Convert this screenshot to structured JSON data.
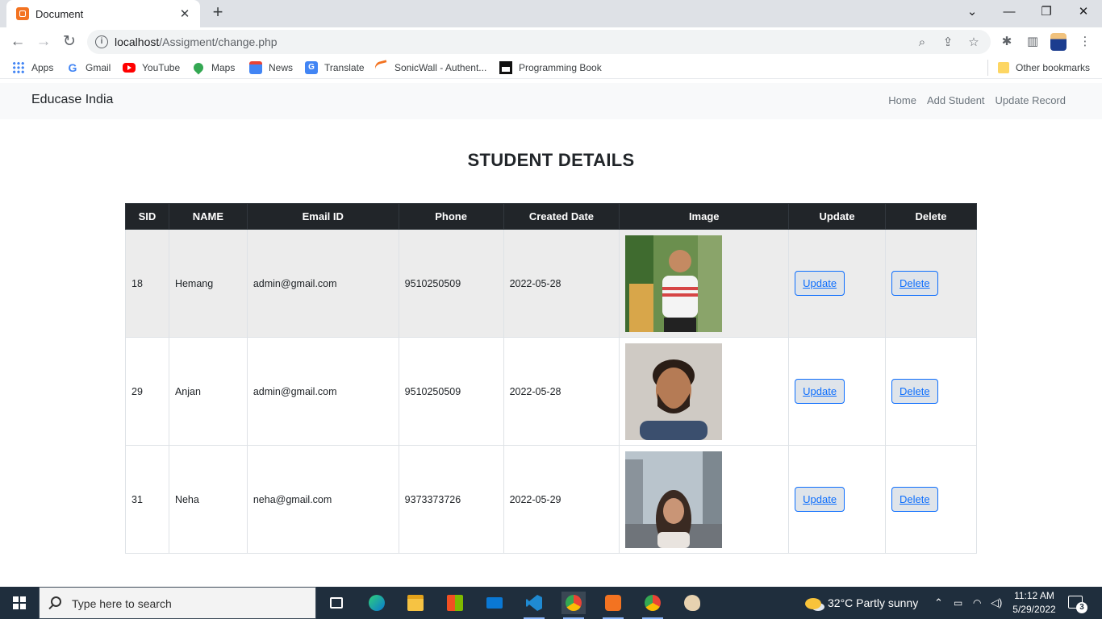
{
  "browser": {
    "tab_title": "Document",
    "url_host": "localhost",
    "url_path": "/Assigment/change.php",
    "bookmarks": [
      {
        "label": "Apps",
        "icon": "apps-grid-icon"
      },
      {
        "label": "Gmail",
        "icon": "google-icon"
      },
      {
        "label": "YouTube",
        "icon": "youtube-icon"
      },
      {
        "label": "Maps",
        "icon": "maps-pin-icon"
      },
      {
        "label": "News",
        "icon": "news-icon"
      },
      {
        "label": "Translate",
        "icon": "translate-icon"
      },
      {
        "label": "SonicWall - Authent...",
        "icon": "sonicwall-icon"
      },
      {
        "label": "Programming Book",
        "icon": "book-icon"
      }
    ],
    "other_bookmarks": "Other bookmarks"
  },
  "navbar": {
    "brand": "Educase India",
    "links": [
      "Home",
      "Add Student",
      "Update Record"
    ]
  },
  "page": {
    "heading": "STUDENT DETAILS"
  },
  "table": {
    "headers": [
      "SID",
      "NAME",
      "Email ID",
      "Phone",
      "Created Date",
      "Image",
      "Update",
      "Delete"
    ],
    "rows": [
      {
        "sid": "18",
        "name": "Hemang",
        "email": "admin@gmail.com",
        "phone": "9510250509",
        "created": "2022-05-28",
        "update_label": "Update",
        "delete_label": "Delete"
      },
      {
        "sid": "29",
        "name": "Anjan",
        "email": "admin@gmail.com",
        "phone": "9510250509",
        "created": "2022-05-28",
        "update_label": "Update",
        "delete_label": "Delete"
      },
      {
        "sid": "31",
        "name": "Neha",
        "email": "neha@gmail.com",
        "phone": "9373373726",
        "created": "2022-05-29",
        "update_label": "Update",
        "delete_label": "Delete"
      }
    ]
  },
  "taskbar": {
    "search_placeholder": "Type here to search",
    "weather": "32°C  Partly sunny",
    "time": "11:12 AM",
    "date": "5/29/2022",
    "notification_count": "3"
  },
  "colors": {
    "accent": "#0d6efd",
    "table_header": "#212529",
    "navbar_bg": "#f8f9fa",
    "taskbar_bg": "#1f2e3d"
  }
}
